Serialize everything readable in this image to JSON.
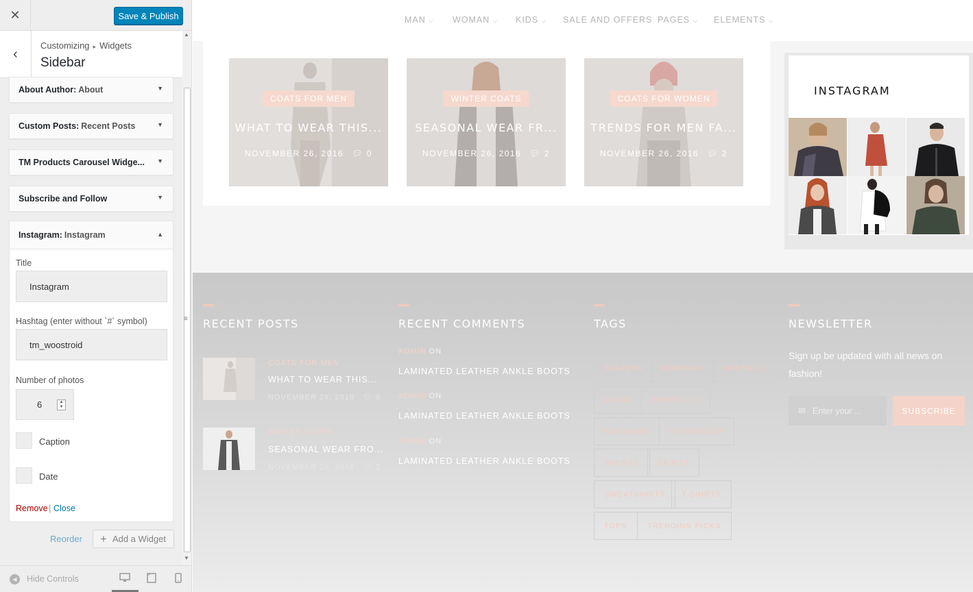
{
  "customizer": {
    "close_icon": "✕",
    "publish_label": "Save & Publish",
    "back_icon": "‹",
    "breadcrumb": [
      "Customizing",
      "Widgets"
    ],
    "breadcrumb_sep": "▸",
    "section_title": "Sidebar",
    "widgets": [
      {
        "type": "About Author:",
        "name": "About"
      },
      {
        "type": "Custom Posts:",
        "name": "Recent Posts"
      },
      {
        "type": "TM Products Carousel Widge...",
        "name": ""
      },
      {
        "type": "Subscribe and Follow",
        "name": ""
      }
    ],
    "open_widget": {
      "type": "Instagram:",
      "name": "Instagram",
      "title_label": "Title",
      "title_value": "Instagram",
      "hashtag_label": "Hashtag (enter without `#` symbol)",
      "hashtag_value": "tm_woostroid",
      "photos_label": "Number of photos",
      "photos_value": "6",
      "caption_label": "Caption",
      "date_label": "Date",
      "remove_label": "Remove",
      "sep": "|",
      "close_label": "Close"
    },
    "reorder_label": "Reorder",
    "add_widget_label": "Add a Widget",
    "hide_controls_label": "Hide Controls"
  },
  "preview": {
    "nav": [
      "MAN",
      "WOMAN",
      "KIDS",
      "SALE AND OFFERS",
      "PAGES",
      "ELEMENTS"
    ],
    "nav_has_chevron": [
      true,
      true,
      true,
      false,
      true,
      true
    ],
    "posts": [
      {
        "category": "COATS FOR MEN",
        "title": "WHAT TO WEAR THIS...",
        "date": "NOVEMBER 26, 2016",
        "comments": "0"
      },
      {
        "category": "WINTER COATS",
        "title": "SEASONAL WEAR FR...",
        "date": "NOVEMBER 26, 2016",
        "comments": "2"
      },
      {
        "category": "COATS FOR WOMEN",
        "title": "TRENDS FOR MEN FA...",
        "date": "NOVEMBER 26, 2016",
        "comments": "2"
      }
    ],
    "instagram_title": "INSTAGRAM",
    "footer": {
      "recent_posts_heading": "RECENT POSTS",
      "recent_posts": [
        {
          "category": "COATS FOR MEN",
          "title": "WHAT TO WEAR THIS...",
          "date": "NOVEMBER 26, 2016",
          "comments": "0"
        },
        {
          "category": "WINTER COATS",
          "title": "SEASONAL WEAR FRO...",
          "date": "NOVEMBER 26, 2016",
          "comments": "2"
        }
      ],
      "recent_comments_heading": "RECENT COMMENTS",
      "recent_comments": [
        {
          "author": "ADMIN",
          "on": "ON",
          "title": "LAMINATED LEATHER ANKLE BOOTS"
        },
        {
          "author": "ADMIN",
          "on": "ON",
          "title": "LAMINATED LEATHER ANKLE BOOTS"
        },
        {
          "author": "ADMIN",
          "on": "ON",
          "title": "LAMINATED LEATHER ANKLE BOOTS"
        }
      ],
      "tags_heading": "TAGS",
      "tags": [
        "BLAZERS",
        "BOMBERS",
        "DRESSES",
        "JEANS",
        "JUMPSUITS",
        "KNITWEAR",
        "OUTERWEAR",
        "SHORTS",
        "SKIRTS",
        "SWEATSHIRTS",
        "T-SHIRTS",
        "TOPS",
        "TRENDING PICKS"
      ],
      "newsletter_heading": "NEWSLETTER",
      "newsletter_text": "Sign up be updated with all news on fashion!",
      "newsletter_placeholder": "Enter your ...",
      "subscribe_label": "SUBSCRIBE"
    }
  },
  "colors": {
    "publish": "#0085ba",
    "accent": "#f3c9bc",
    "link": "#0073aa",
    "remove": "#aa0000"
  }
}
